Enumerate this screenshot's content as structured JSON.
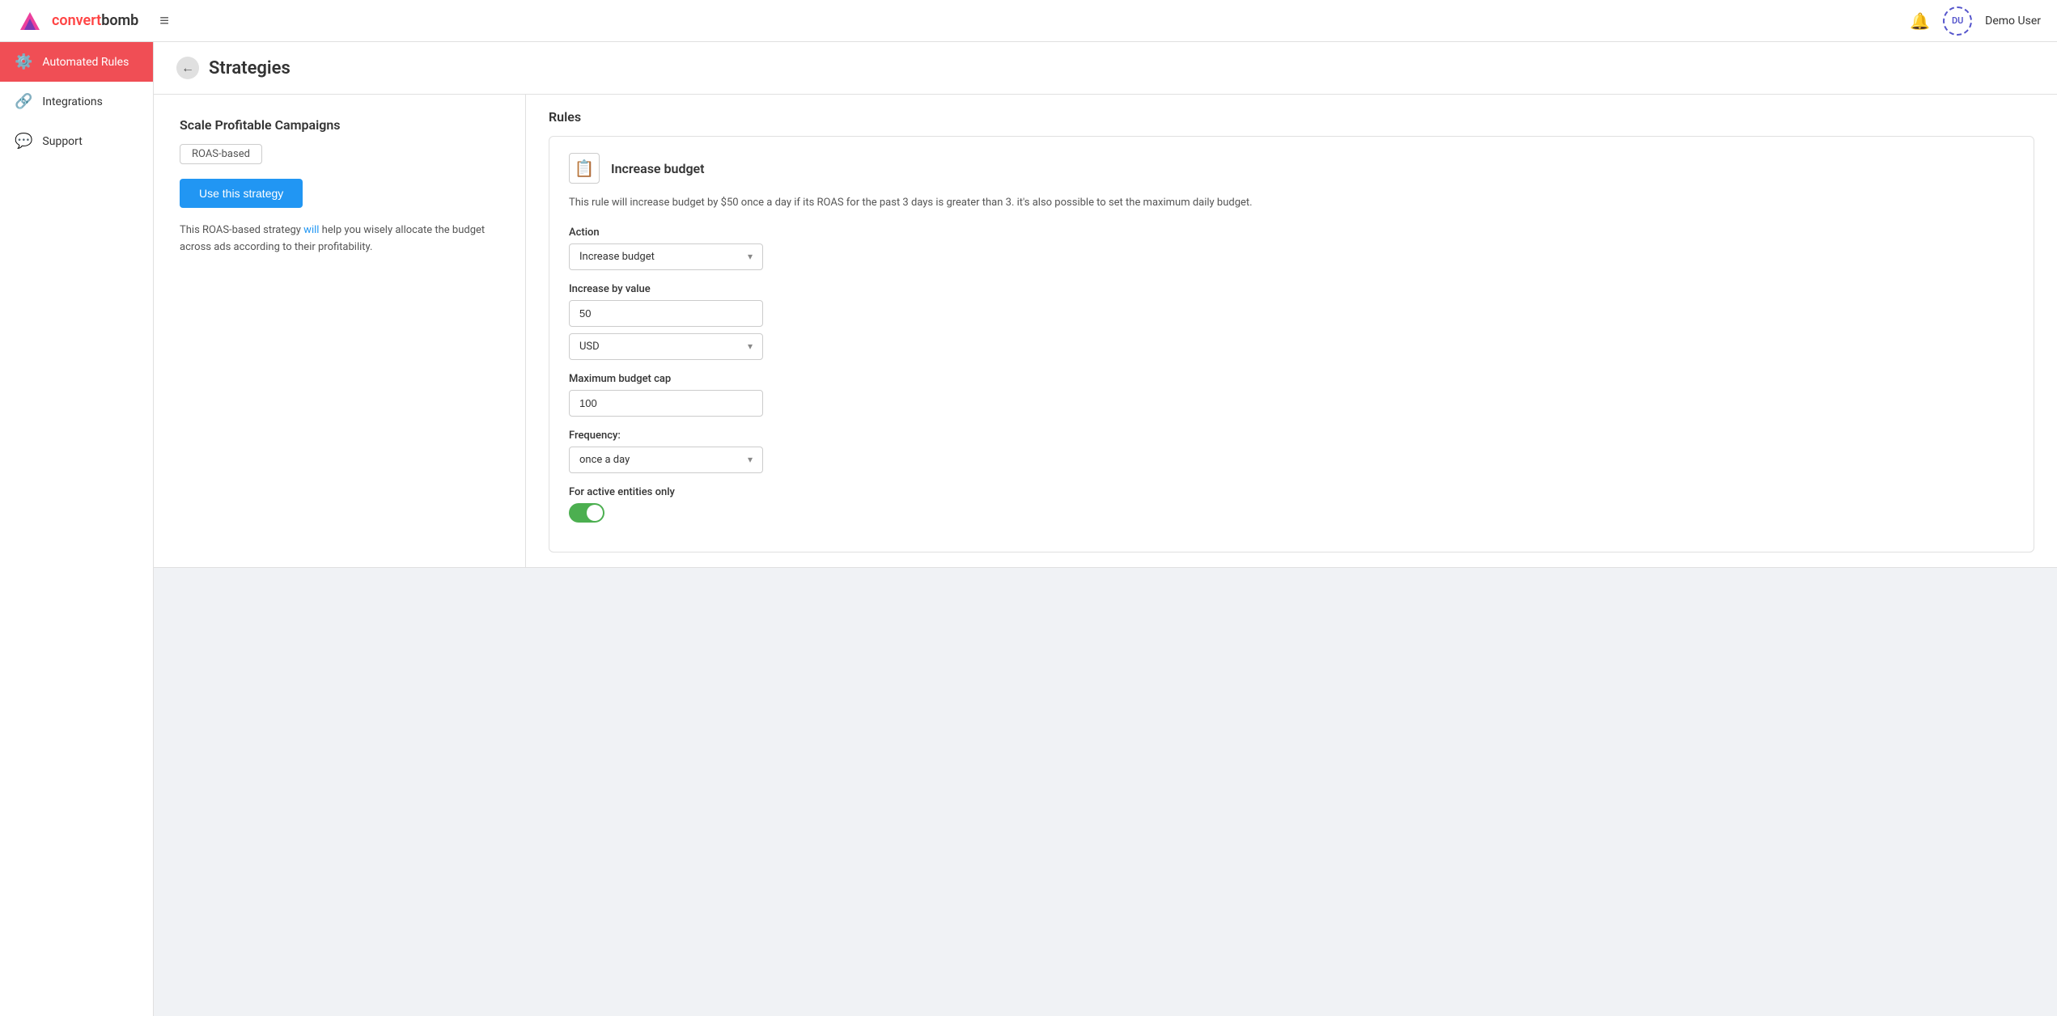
{
  "app": {
    "logo_text_convert": "convert",
    "logo_text_bomb": "bomb",
    "hamburger_icon": "≡",
    "bell_icon": "🔔",
    "avatar_initials": "DU",
    "user_name": "Demo User"
  },
  "sidebar": {
    "items": [
      {
        "id": "automated-rules",
        "label": "Automated Rules",
        "icon": "⚙",
        "active": true
      },
      {
        "id": "integrations",
        "label": "Integrations",
        "icon": "🔗",
        "active": false
      },
      {
        "id": "support",
        "label": "Support",
        "icon": "💬",
        "active": false
      }
    ]
  },
  "page": {
    "back_icon": "←",
    "title": "Strategies"
  },
  "strategy": {
    "name": "Scale Profitable Campaigns",
    "tag": "ROAS-based",
    "use_button": "Use this strategy",
    "description": "This ROAS-based strategy will help you wisely allocate the budget across ads according to their profitability.",
    "description_link": "will"
  },
  "rules": {
    "label": "Rules",
    "card": {
      "icon": "📋",
      "title": "Increase budget",
      "description": "This rule will increase budget by $50 once a day if its ROAS for the past 3 days is greater than 3. it's also possible to set the maximum daily budget.",
      "action_label": "Action",
      "action_value": "Increase budget",
      "action_chevron": "▾",
      "increase_by_label": "Increase by value",
      "increase_by_value": "50",
      "currency_value": "USD",
      "currency_chevron": "▾",
      "max_budget_label": "Maximum budget cap",
      "max_budget_value": "100",
      "frequency_label": "Frequency:",
      "frequency_value": "once a day",
      "frequency_chevron": "▾",
      "active_entities_label": "For active entities only"
    }
  }
}
